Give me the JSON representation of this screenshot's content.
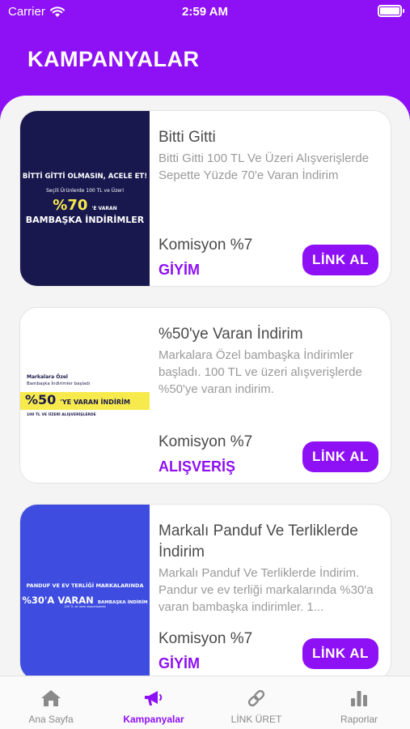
{
  "status_bar": {
    "carrier": "Carrier",
    "time": "2:59 AM"
  },
  "header": {
    "title": "KAMPANYALAR"
  },
  "colors": {
    "brand": "#8e10f5",
    "campaign1_bg": "#18184e",
    "campaign3_bg": "#3e4de0",
    "highlight_yellow": "#f7ea4d"
  },
  "campaigns": [
    {
      "title": "Bitti Gitti",
      "description": "Bitti Gitti 100 TL Ve Üzeri Alışverişlerde Sepette Yüzde 70'e Varan İndirim",
      "commission": "Komisyon %7",
      "category": "GİYİM",
      "button": "LİNK AL",
      "image": {
        "line1": "BİTTİ GİTTİ OLMASIN, ACELE ET!",
        "line2": "Seçili Ürünlerde 100 TL ve Üzeri",
        "big": "%70",
        "suffix": "'E VARAN",
        "line3": "BAMBAŞKA İNDİRİMLER"
      }
    },
    {
      "title": "%50'ye Varan İndirim",
      "description": "Markalara Özel bambaşka İndirimler başladı. 100 TL ve üzeri alışverişlerde %50'ye varan indirim.",
      "commission": "Komisyon %7",
      "category": "ALIŞVERİŞ",
      "button": "LİNK AL",
      "image": {
        "line1": "Markalara Özel",
        "line2": "Bambaşka İndirimler başladı",
        "big": "%50",
        "suffix": "'YE VARAN İNDİRİM",
        "line3": "100 TL VE ÜZERİ ALIŞVERİŞLERDE"
      }
    },
    {
      "title": "Markalı Panduf Ve Terliklerde İndirim",
      "description": "Markalı Panduf Ve Terliklerde İndirim. Pandur ve ev terliği markalarında %30'a varan bambaşka indirimler. 1...",
      "commission": "Komisyon %7",
      "category": "GİYİM",
      "button": "LİNK AL",
      "image": {
        "line1": "PANDUF VE EV TERLİĞİ MARKALARINDA",
        "big": "%30'A VARAN",
        "suffix": "BAMBAŞKA İNDİRİM",
        "line3": "100 TL ve üzeri alışverişlerde"
      }
    }
  ],
  "tabs": [
    {
      "label": "Ana Sayfa",
      "icon": "home-icon"
    },
    {
      "label": "Kampanyalar",
      "icon": "megaphone-icon"
    },
    {
      "label": "LİNK ÜRET",
      "icon": "link-icon"
    },
    {
      "label": "Raporlar",
      "icon": "bar-chart-icon"
    }
  ]
}
